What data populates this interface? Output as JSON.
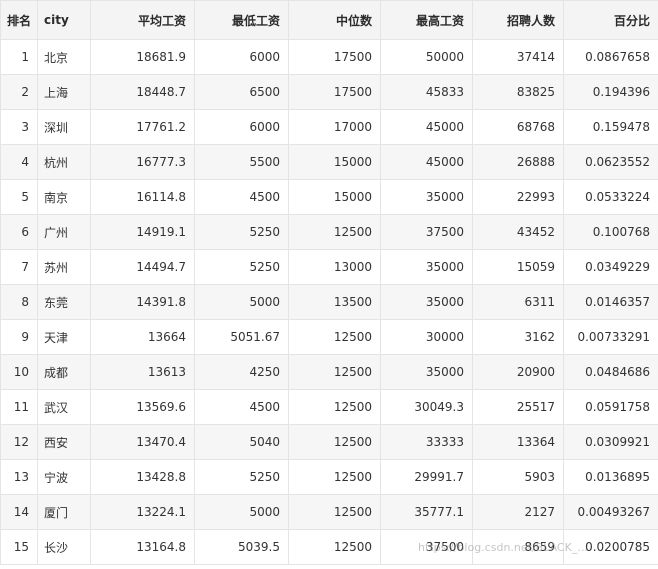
{
  "table": {
    "columns": [
      "排名",
      "city",
      "平均工资",
      "最低工资",
      "中位数",
      "最高工资",
      "招聘人数",
      "百分比"
    ],
    "rows": [
      [
        "1",
        "北京",
        "18681.9",
        "6000",
        "17500",
        "50000",
        "37414",
        "0.0867658"
      ],
      [
        "2",
        "上海",
        "18448.7",
        "6500",
        "17500",
        "45833",
        "83825",
        "0.194396"
      ],
      [
        "3",
        "深圳",
        "17761.2",
        "6000",
        "17000",
        "45000",
        "68768",
        "0.159478"
      ],
      [
        "4",
        "杭州",
        "16777.3",
        "5500",
        "15000",
        "45000",
        "26888",
        "0.0623552"
      ],
      [
        "5",
        "南京",
        "16114.8",
        "4500",
        "15000",
        "35000",
        "22993",
        "0.0533224"
      ],
      [
        "6",
        "广州",
        "14919.1",
        "5250",
        "12500",
        "37500",
        "43452",
        "0.100768"
      ],
      [
        "7",
        "苏州",
        "14494.7",
        "5250",
        "13000",
        "35000",
        "15059",
        "0.0349229"
      ],
      [
        "8",
        "东莞",
        "14391.8",
        "5000",
        "13500",
        "35000",
        "6311",
        "0.0146357"
      ],
      [
        "9",
        "天津",
        "13664",
        "5051.67",
        "12500",
        "30000",
        "3162",
        "0.00733291"
      ],
      [
        "10",
        "成都",
        "13613",
        "4250",
        "12500",
        "35000",
        "20900",
        "0.0484686"
      ],
      [
        "11",
        "武汉",
        "13569.6",
        "4500",
        "12500",
        "30049.3",
        "25517",
        "0.0591758"
      ],
      [
        "12",
        "西安",
        "13470.4",
        "5040",
        "12500",
        "33333",
        "13364",
        "0.0309921"
      ],
      [
        "13",
        "宁波",
        "13428.8",
        "5250",
        "12500",
        "29991.7",
        "5903",
        "0.0136895"
      ],
      [
        "14",
        "厦门",
        "13224.1",
        "5000",
        "12500",
        "35777.1",
        "2127",
        "0.00493267"
      ],
      [
        "15",
        "长沙",
        "13164.8",
        "5039.5",
        "12500",
        "37500",
        "8659",
        "0.0200785"
      ]
    ]
  },
  "watermark": "https://blog.csdn.net/BLACK_..."
}
